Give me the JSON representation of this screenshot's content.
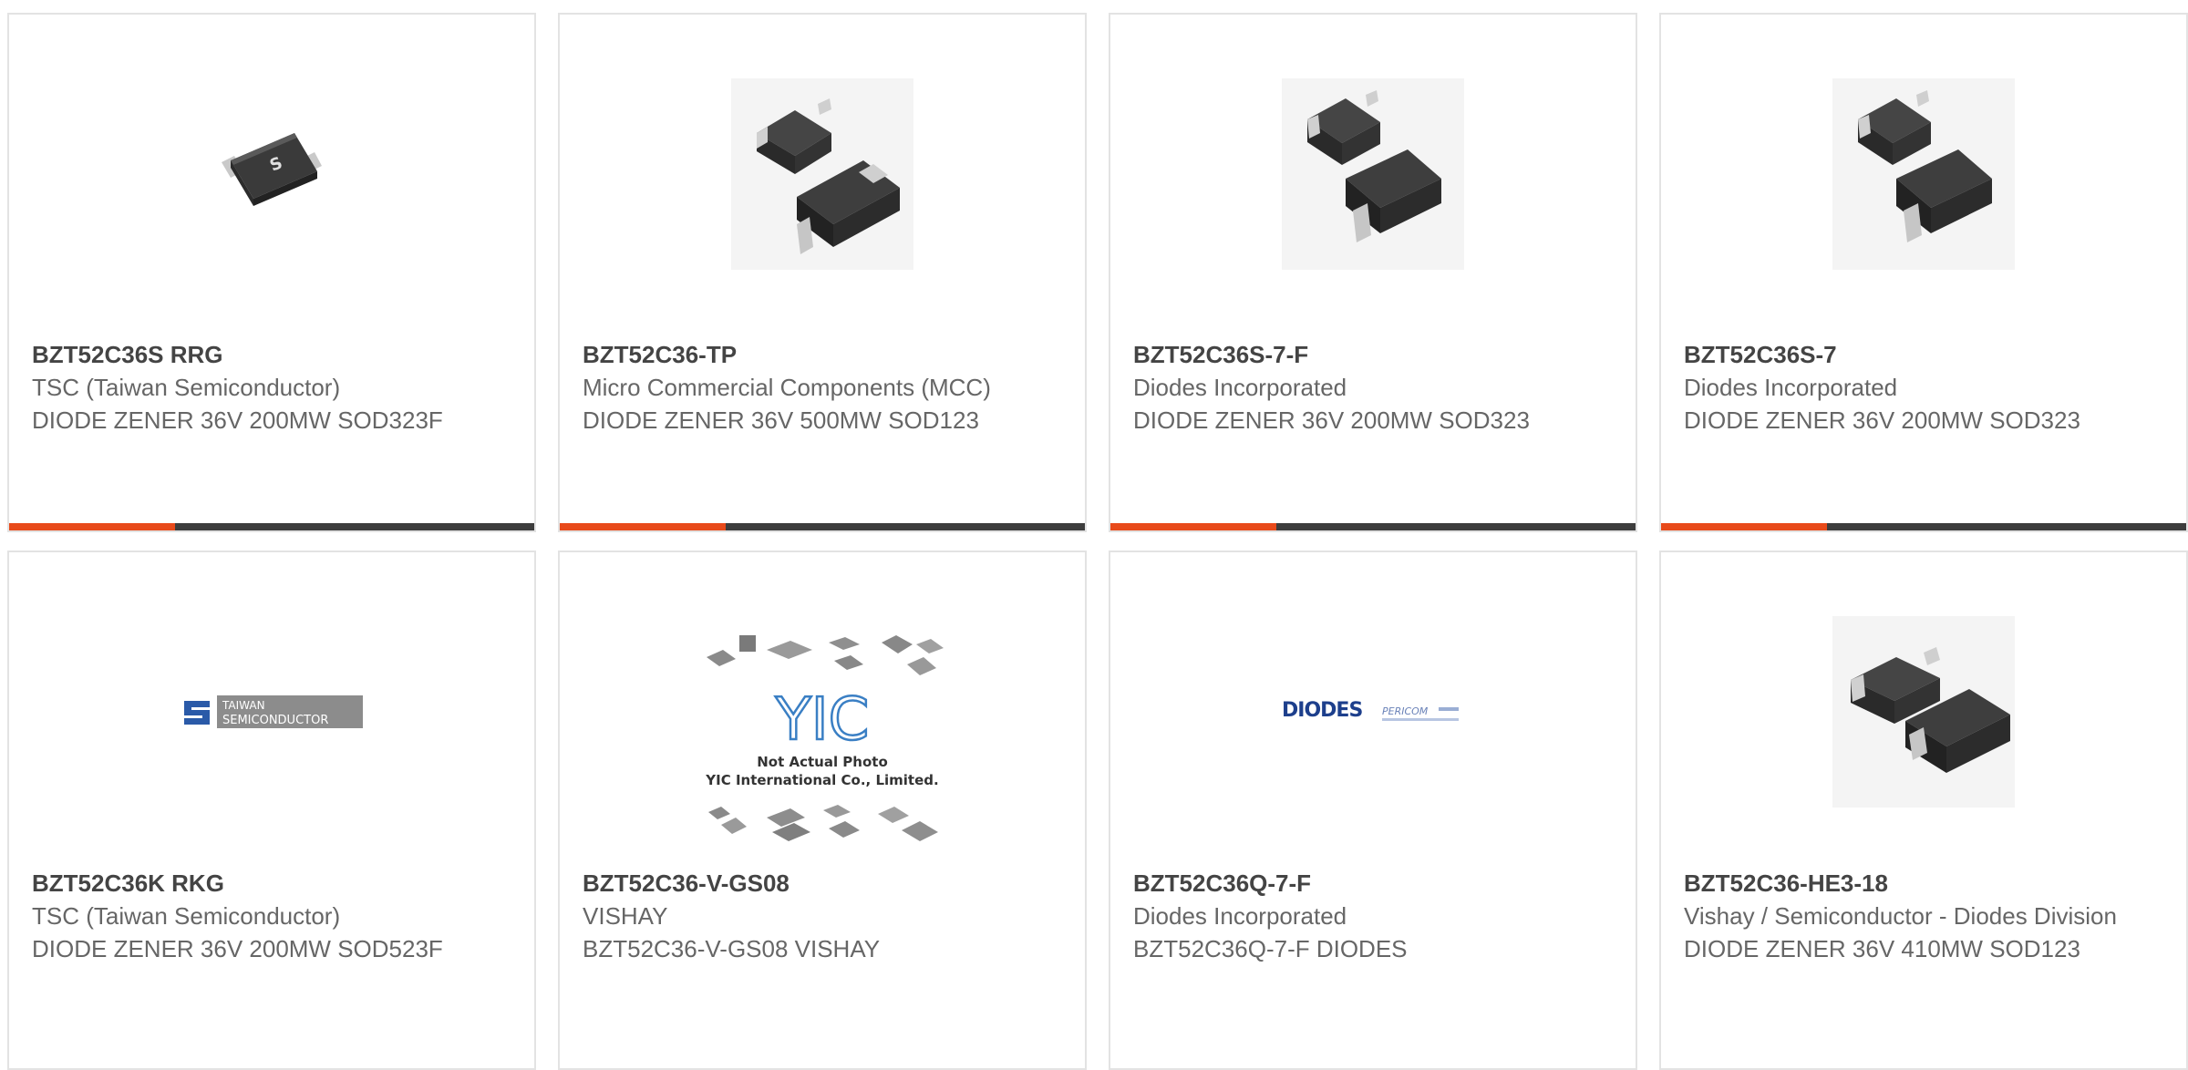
{
  "colors": {
    "accent": "#e84a1a",
    "bar_dark": "#3d3d3d",
    "card_border": "#e3e3e3",
    "part_number_text": "#444444",
    "body_text": "#666666"
  },
  "cards": [
    {
      "part_number": "BZT52C36S RRG",
      "manufacturer": "TSC (Taiwan Semiconductor)",
      "description": "DIODE ZENER 36V 200MW SOD323F",
      "image_icon": "sod323f-package-icon"
    },
    {
      "part_number": "BZT52C36-TP",
      "manufacturer": "Micro Commercial Components (MCC)",
      "description": "DIODE ZENER 36V 500MW SOD123",
      "image_icon": "sod123-package-icon"
    },
    {
      "part_number": "BZT52C36S-7-F",
      "manufacturer": "Diodes Incorporated",
      "description": "DIODE ZENER 36V 200MW SOD323",
      "image_icon": "sod323-package-icon"
    },
    {
      "part_number": "BZT52C36S-7",
      "manufacturer": "Diodes Incorporated",
      "description": "DIODE ZENER 36V 200MW SOD323",
      "image_icon": "sod323-package-icon"
    },
    {
      "part_number": "BZT52C36K RKG",
      "manufacturer": "TSC (Taiwan Semiconductor)",
      "description": "DIODE ZENER 36V 200MW SOD523F",
      "image_icon": "taiwan-semiconductor-logo",
      "logo_text": [
        "TAIWAN",
        "SEMICONDUCTOR"
      ]
    },
    {
      "part_number": "BZT52C36-V-GS08",
      "manufacturer": "VISHAY",
      "description": "BZT52C36-V-GS08 VISHAY",
      "image_icon": "yic-placeholder-image",
      "logo_text": [
        "YIC",
        "Not Actual Photo",
        "YIC International Co., Limited."
      ]
    },
    {
      "part_number": "BZT52C36Q-7-F",
      "manufacturer": "Diodes Incorporated",
      "description": "BZT52C36Q-7-F DIODES",
      "image_icon": "diodes-pericom-logo",
      "logo_text": [
        "DIODES",
        "PERICOM"
      ]
    },
    {
      "part_number": "BZT52C36-HE3-18",
      "manufacturer": "Vishay / Semiconductor - Diodes Division",
      "description": "DIODE ZENER 36V 410MW SOD123",
      "image_icon": "sod123-package-icon"
    }
  ]
}
